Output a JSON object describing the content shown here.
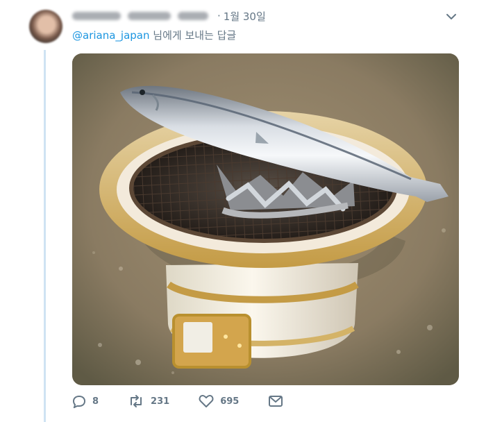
{
  "tweet": {
    "date": "1월 30일",
    "separator": "·",
    "reply_to": {
      "handle": "@ariana_japan",
      "suffix": "님에게 보내는 답글"
    },
    "image": {
      "description_icon": "photo"
    }
  },
  "actions": {
    "reply_count": "8",
    "retweet_count": "231",
    "like_count": "695"
  },
  "colors": {
    "link": "#1b95e0",
    "muted": "#657786",
    "thread_line": "#cfe3f3"
  },
  "icons": [
    "chevron-down-icon",
    "reply-icon",
    "retweet-icon",
    "like-icon",
    "message-icon"
  ]
}
